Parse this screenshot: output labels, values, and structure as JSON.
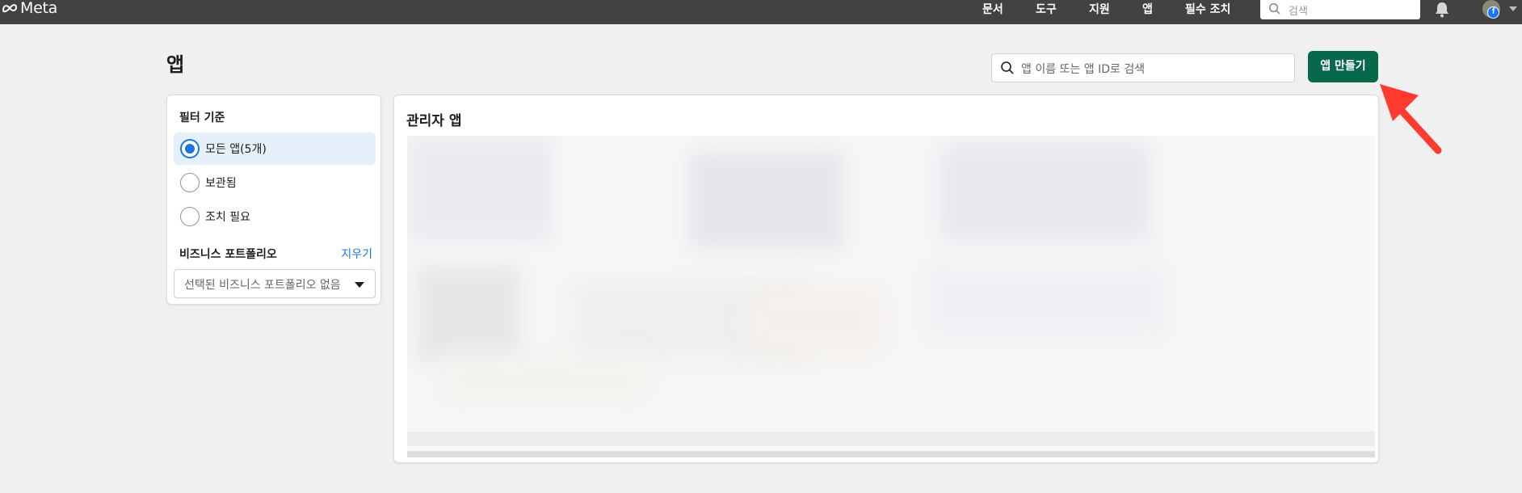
{
  "topbar": {
    "logo_text": "Meta",
    "nav": [
      "문서",
      "도구",
      "지원",
      "앱",
      "필수 조치"
    ],
    "search_placeholder": "검색",
    "fb_badge": "f"
  },
  "page": {
    "title": "앱",
    "search_placeholder": "앱 이름 또는 앱 ID로 검색",
    "create_button": "앱 만들기"
  },
  "filter": {
    "title": "필터 기준",
    "options": [
      {
        "label": "모든 앱(5개)",
        "selected": true
      },
      {
        "label": "보관됨",
        "selected": false
      },
      {
        "label": "조치 필요",
        "selected": false
      }
    ],
    "business_title": "비즈니스 포트폴리오",
    "clear_label": "지우기",
    "business_select_value": "선택된 비즈니스 포트폴리오 없음"
  },
  "apps_section": {
    "title": "관리자 앱"
  },
  "colors": {
    "topbar": "#424242",
    "create_button": "#06694b",
    "accent_blue": "#1b74e4",
    "arrow": "#ff3b30"
  }
}
